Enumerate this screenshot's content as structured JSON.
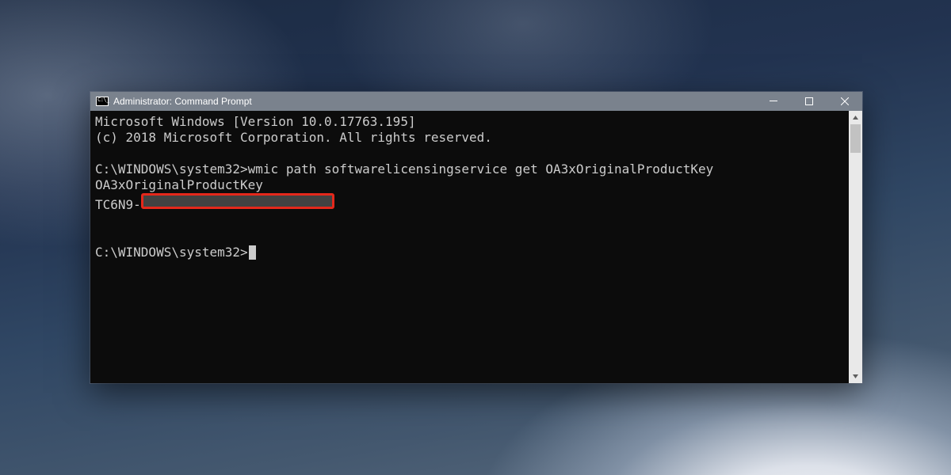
{
  "window": {
    "title": "Administrator: Command Prompt"
  },
  "console": {
    "banner_line1": "Microsoft Windows [Version 10.0.17763.195]",
    "banner_line2": "(c) 2018 Microsoft Corporation. All rights reserved.",
    "prompt1_path": "C:\\WINDOWS\\system32>",
    "prompt1_cmd": "wmic path softwarelicensingservice get OA3xOriginalProductKey",
    "result_header": "OA3xOriginalProductKey",
    "result_prefix": "TC6N9-",
    "prompt2_path": "C:\\WINDOWS\\system32>"
  }
}
